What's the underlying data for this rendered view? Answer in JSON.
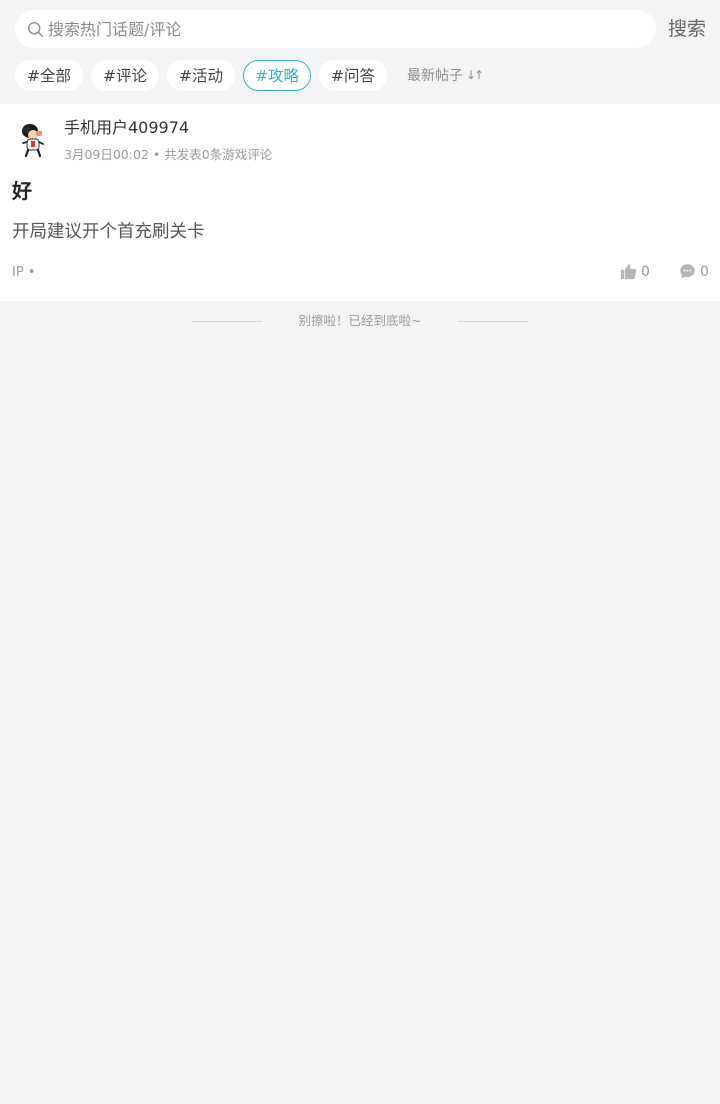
{
  "search": {
    "placeholder": "搜索热门话题/评论",
    "value": "",
    "button_label": "搜索"
  },
  "tags": [
    {
      "label": "#全部",
      "active": false
    },
    {
      "label": "#评论",
      "active": false
    },
    {
      "label": "#活动",
      "active": false
    },
    {
      "label": "#攻略",
      "active": true
    },
    {
      "label": "#问答",
      "active": false
    }
  ],
  "sort": {
    "label": "最新帖子",
    "icon": "sort-arrows-icon"
  },
  "post": {
    "username": "手机用户409974",
    "time": "3月09日00:02",
    "separator": "•",
    "stats": "共发表0条游戏评论",
    "title": "好",
    "body": "开局建议开个首充刷关卡",
    "ip": "IP •",
    "likes": "0",
    "comments": "0"
  },
  "footer": {
    "end_text": "别擦啦！已经到底啦~"
  },
  "colors": {
    "accent": "#3bb0c3",
    "background": "#f3f4f6",
    "card": "#ffffff"
  }
}
